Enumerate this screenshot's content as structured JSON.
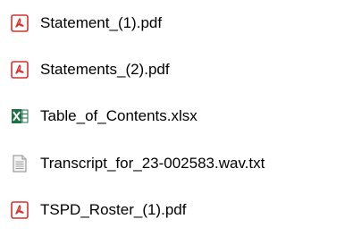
{
  "files": [
    {
      "name": "Statement_(1).pdf",
      "icon": "pdf-icon"
    },
    {
      "name": "Statements_(2).pdf",
      "icon": "pdf-icon"
    },
    {
      "name": "Table_of_Contents.xlsx",
      "icon": "excel-icon"
    },
    {
      "name": "Transcript_for_23-002583.wav.txt",
      "icon": "text-file-icon"
    },
    {
      "name": "TSPD_Roster_(1).pdf",
      "icon": "pdf-icon"
    }
  ],
  "colors": {
    "pdf_red": "#d9302c",
    "excel_green": "#1e7145",
    "text_gray": "#8a8a8a"
  }
}
